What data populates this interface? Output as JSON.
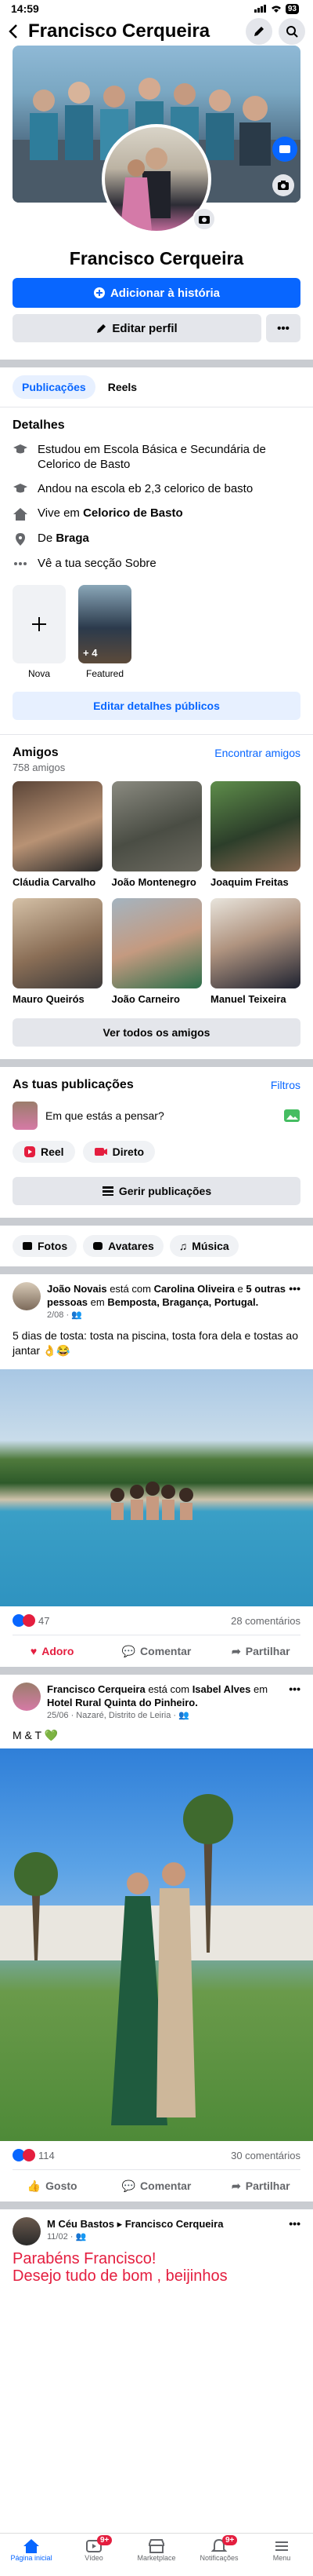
{
  "status": {
    "time": "14:59",
    "battery": "93"
  },
  "header": {
    "title": "Francisco Cerqueira"
  },
  "profile": {
    "name": "Francisco Cerqueira",
    "add_story": "Adicionar à história",
    "edit_profile": "Editar perfil"
  },
  "tabs": [
    "Publicações",
    "Reels"
  ],
  "details": {
    "title": "Detalhes",
    "studied_prefix": "Estudou em ",
    "studied_place": "Escola Básica e Secundária de Celorico de Basto",
    "went_prefix": "Andou na escola ",
    "went_place": "eb 2,3 celorico de basto",
    "lives_prefix": "Vive em ",
    "lives_place": "Celorico de Basto",
    "from_prefix": "De ",
    "from_place": "Braga",
    "see_about": "Vê a tua secção Sobre"
  },
  "featured": {
    "new_label": "Nova",
    "featured_label": "Featured",
    "count": "+ 4",
    "edit": "Editar detalhes públicos"
  },
  "friends": {
    "title": "Amigos",
    "find": "Encontrar amigos",
    "count": "758 amigos",
    "list": [
      {
        "name": "Cláudia Carvalho"
      },
      {
        "name": "João Montenegro"
      },
      {
        "name": "Joaquim Freitas"
      },
      {
        "name": "Mauro Queirós"
      },
      {
        "name": "João Carneiro"
      },
      {
        "name": "Manuel Teixeira"
      }
    ],
    "see_all": "Ver todos os amigos"
  },
  "your_posts": {
    "title": "As tuas publicações",
    "filters": "Filtros",
    "composer": "Em que estás a pensar?",
    "reel": "Reel",
    "live": "Direto",
    "manage": "Gerir publicações"
  },
  "chips": [
    "Fotos",
    "Avatares",
    "Música"
  ],
  "post1": {
    "author": "João Novais",
    "with": " está com ",
    "tagged1": "Carolina Oliveira",
    "and": " e ",
    "tagged2": "5 outras pessoas",
    "at": " em ",
    "place": "Bemposta, Bragança, Portugal",
    "date": "2/08 · ",
    "text": "5 dias de tosta: tosta na piscina, tosta fora dela e tostas ao jantar 👌😂",
    "reactions": "47",
    "comments": "28 comentários",
    "like": "Adoro",
    "comment": "Comentar",
    "share": "Partilhar"
  },
  "post2": {
    "author": "Francisco Cerqueira",
    "with": " está com ",
    "tagged": "Isabel Alves",
    "at": " em ",
    "place": "Hotel Rural Quinta do Pinheiro",
    "date": "25/06 · Nazaré, Distrito de Leiria · ",
    "text": "M & T 💚",
    "reactions": "114",
    "comments": "30 comentários",
    "like": "Gosto",
    "comment": "Comentar",
    "share": "Partilhar"
  },
  "post3": {
    "author": "M Céu Bastos",
    "arrow": " ▸ ",
    "target": "Francisco Cerqueira",
    "date": "11/02 · ",
    "text1": "Parabéns Francisco!",
    "text2": "Desejo tudo de bom , beijinhos"
  },
  "nav": [
    {
      "label": "Página inicial"
    },
    {
      "label": "Vídeo",
      "badge": "9+"
    },
    {
      "label": "Marketplace"
    },
    {
      "label": "Notificações",
      "badge": "9+"
    },
    {
      "label": "Menu"
    }
  ],
  "colors": {
    "accent": "#0866ff",
    "divider": "#c9ccd1",
    "love": "#e41e3f"
  }
}
